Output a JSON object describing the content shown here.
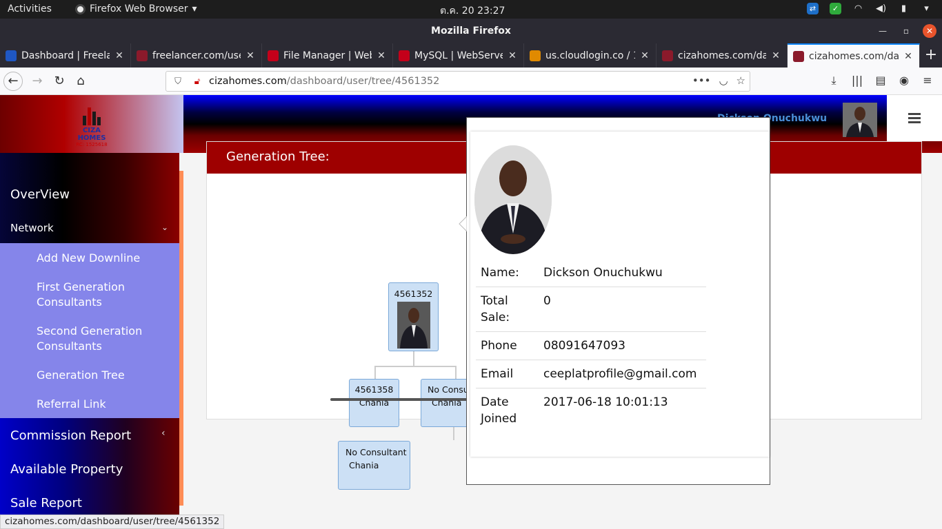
{
  "gnome": {
    "activities": "Activities",
    "app_name": "Firefox Web Browser",
    "clock": "ต.ค. 20  23:27"
  },
  "window": {
    "title": "Mozilla Firefox"
  },
  "tabs": [
    {
      "label": "Dashboard | Freelar",
      "color": "#1f57c3"
    },
    {
      "label": "freelancer.com/use",
      "color": "#8b1a2b"
    },
    {
      "label": "File Manager | Web",
      "color": "#c4001a"
    },
    {
      "label": "MySQL | WebServer",
      "color": "#c4001a"
    },
    {
      "label": "us.cloudlogin.co / 1",
      "color": "#e08a00"
    },
    {
      "label": "cizahomes.com/das",
      "color": "#8b1a2b"
    },
    {
      "label": "cizahomes.com/das",
      "color": "#8b1a2b",
      "active": true
    }
  ],
  "address": {
    "host": "cizahomes.com",
    "path": "/dashboard/user/tree/4561352"
  },
  "site": {
    "logo_brand": "CIZA HOMES",
    "logo_rc": "RC: 1525618",
    "header_user": "Dickson Onuchukwu",
    "panel_title": "Generation Tree:"
  },
  "sidebar": {
    "overview": "OverView",
    "network": "Network",
    "submenu": [
      "Add New Downline",
      "First Generation Consultants",
      "Second Generation Consultants",
      "Generation Tree",
      "Referral Link"
    ],
    "bottom": [
      "Commission Report",
      "Available Property",
      "Sale Report"
    ]
  },
  "tree": {
    "root": "4561352",
    "child1_id": "4561358",
    "child1_place": "Chania",
    "child2_label": "No Consu",
    "child2_place": "Chania",
    "grand_label": "No Consultant",
    "grand_place": "Chania"
  },
  "popover": {
    "rows": [
      {
        "k": "Name:",
        "v": "Dickson Onuchukwu"
      },
      {
        "k": "Total Sale:",
        "v": "0"
      },
      {
        "k": "Phone",
        "v": "08091647093"
      },
      {
        "k": "Email",
        "v": "ceeplatprofile@gmail.com"
      },
      {
        "k": "Date Joined",
        "v": "2017-06-18 10:01:13"
      }
    ]
  },
  "status_url": "cizahomes.com/dashboard/user/tree/4561352"
}
